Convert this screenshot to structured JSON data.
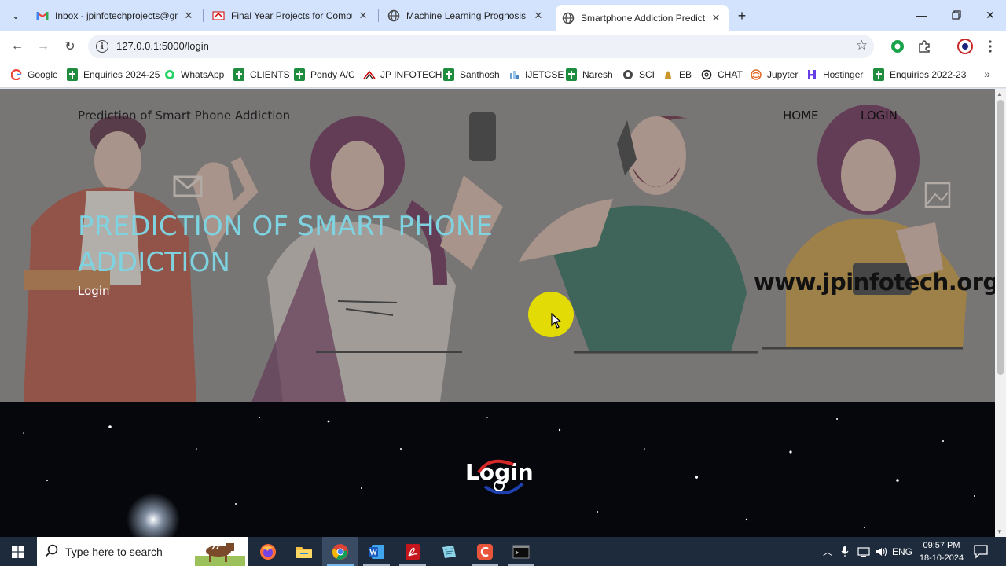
{
  "browser": {
    "tabs": [
      {
        "title": "Inbox - jpinfotechprojects@gm",
        "icon": "gmail-icon",
        "active": false
      },
      {
        "title": "Final Year Projects for Compute",
        "icon": "site-logo-icon",
        "active": false
      },
      {
        "title": "Machine Learning Prognosis fo",
        "icon": "globe-icon",
        "active": false
      },
      {
        "title": "Smartphone Addiction Predictio",
        "icon": "globe-icon",
        "active": true
      }
    ],
    "url": "127.0.0.1:5000/login",
    "bookmarks": [
      {
        "label": "Google",
        "icon": "google-icon"
      },
      {
        "label": "Enquiries 2024-25",
        "icon": "sheets-icon"
      },
      {
        "label": "WhatsApp",
        "icon": "whatsapp-icon"
      },
      {
        "label": "CLIENTS",
        "icon": "sheets-icon"
      },
      {
        "label": "Pondy A/C",
        "icon": "sheets-icon"
      },
      {
        "label": "JP INFOTECH",
        "icon": "site-logo-icon"
      },
      {
        "label": "Santhosh",
        "icon": "sheets-icon"
      },
      {
        "label": "IJETCSE",
        "icon": "journal-icon"
      },
      {
        "label": "Naresh",
        "icon": "sheets-icon"
      },
      {
        "label": "SCI",
        "icon": "globe-icon"
      },
      {
        "label": "EB",
        "icon": "emblem-icon"
      },
      {
        "label": "CHAT",
        "icon": "openai-icon"
      },
      {
        "label": "Jupyter",
        "icon": "jupyter-icon"
      },
      {
        "label": "Hostinger",
        "icon": "hostinger-icon"
      },
      {
        "label": "Enquiries 2022-23",
        "icon": "sheets-icon"
      }
    ]
  },
  "page": {
    "brand": "Prediction of Smart Phone Addiction",
    "nav": {
      "home": "HOME",
      "login": "LOGIN"
    },
    "hero_title": "PREDICTION OF SMART PHONE ADDICTION",
    "hero_subtitle": "Login",
    "watermark": "www.jpinfotech.org",
    "login_heading": "Login",
    "colors": {
      "hero_title": "#7fd3e0",
      "login_bg": "#05070c",
      "cursor_highlight": "#e8e000"
    }
  },
  "taskbar": {
    "search_placeholder": "Type here to search",
    "apps": [
      "firefox-icon",
      "file-explorer-icon",
      "chrome-icon",
      "word-icon",
      "acrobat-icon",
      "notepad-icon",
      "app-c-icon",
      "terminal-icon"
    ],
    "language": "ENG",
    "time": "09:57 PM",
    "date": "18-10-2024"
  }
}
